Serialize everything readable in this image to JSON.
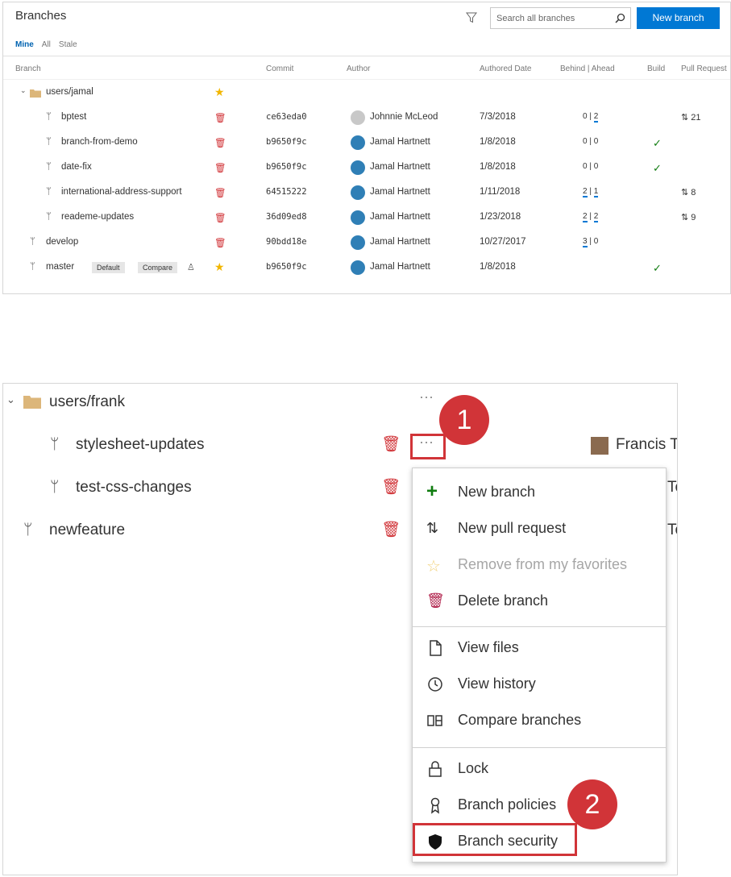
{
  "top": {
    "title": "Branches",
    "search_placeholder": "Search all branches",
    "new_branch_label": "New branch",
    "tabs": [
      "Mine",
      "All",
      "Stale"
    ],
    "columns": [
      "Branch",
      "Commit",
      "Author",
      "Authored Date",
      "Behind | Ahead",
      "Build",
      "Pull Request"
    ],
    "folder": "users/jamal",
    "rows": [
      {
        "name": "bptest",
        "commit": "ce63eda0",
        "author": "Johnnie McLeod",
        "date": "7/3/2018",
        "behind": "0",
        "ahead": "2",
        "build": "",
        "pr": "21"
      },
      {
        "name": "branch-from-demo",
        "commit": "b9650f9c",
        "author": "Jamal Hartnett",
        "date": "1/8/2018",
        "behind": "0",
        "ahead": "0",
        "build": "✓",
        "pr": ""
      },
      {
        "name": "date-fix",
        "commit": "b9650f9c",
        "author": "Jamal Hartnett",
        "date": "1/8/2018",
        "behind": "0",
        "ahead": "0",
        "build": "✓",
        "pr": ""
      },
      {
        "name": "international-address-support",
        "commit": "64515222",
        "author": "Jamal Hartnett",
        "date": "1/11/2018",
        "behind": "2",
        "ahead": "1",
        "build": "",
        "pr": "8"
      },
      {
        "name": "reademe-updates",
        "commit": "36d09ed8",
        "author": "Jamal Hartnett",
        "date": "1/23/2018",
        "behind": "2",
        "ahead": "2",
        "build": "",
        "pr": "9"
      },
      {
        "name": "develop",
        "commit": "90bdd18e",
        "author": "Jamal Hartnett",
        "date": "10/27/2017",
        "behind": "3",
        "ahead": "0",
        "build": "",
        "pr": ""
      },
      {
        "name": "master",
        "commit": "b9650f9c",
        "author": "Jamal Hartnett",
        "date": "1/8/2018",
        "behind": "",
        "ahead": "",
        "build": "✓",
        "pr": ""
      }
    ],
    "master_tags": [
      "Default",
      "Compare"
    ]
  },
  "bottom": {
    "folder": "users/frank",
    "branches": [
      "stylesheet-updates",
      "test-css-changes",
      "newfeature"
    ],
    "author_partial": "Francis To",
    "author_clip": "To",
    "menu": {
      "group1": [
        "New branch",
        "New pull request",
        "Remove from my favorites",
        "Delete branch"
      ],
      "group2": [
        "View files",
        "View history",
        "Compare branches"
      ],
      "group3": [
        "Lock",
        "Branch policies",
        "Branch security"
      ]
    },
    "callouts": [
      "1",
      "2"
    ]
  },
  "colors": {
    "accent": "#0078d4",
    "delete": "#d13438",
    "star": "#f2b600",
    "check": "#107c10",
    "callout": "#d13438"
  }
}
